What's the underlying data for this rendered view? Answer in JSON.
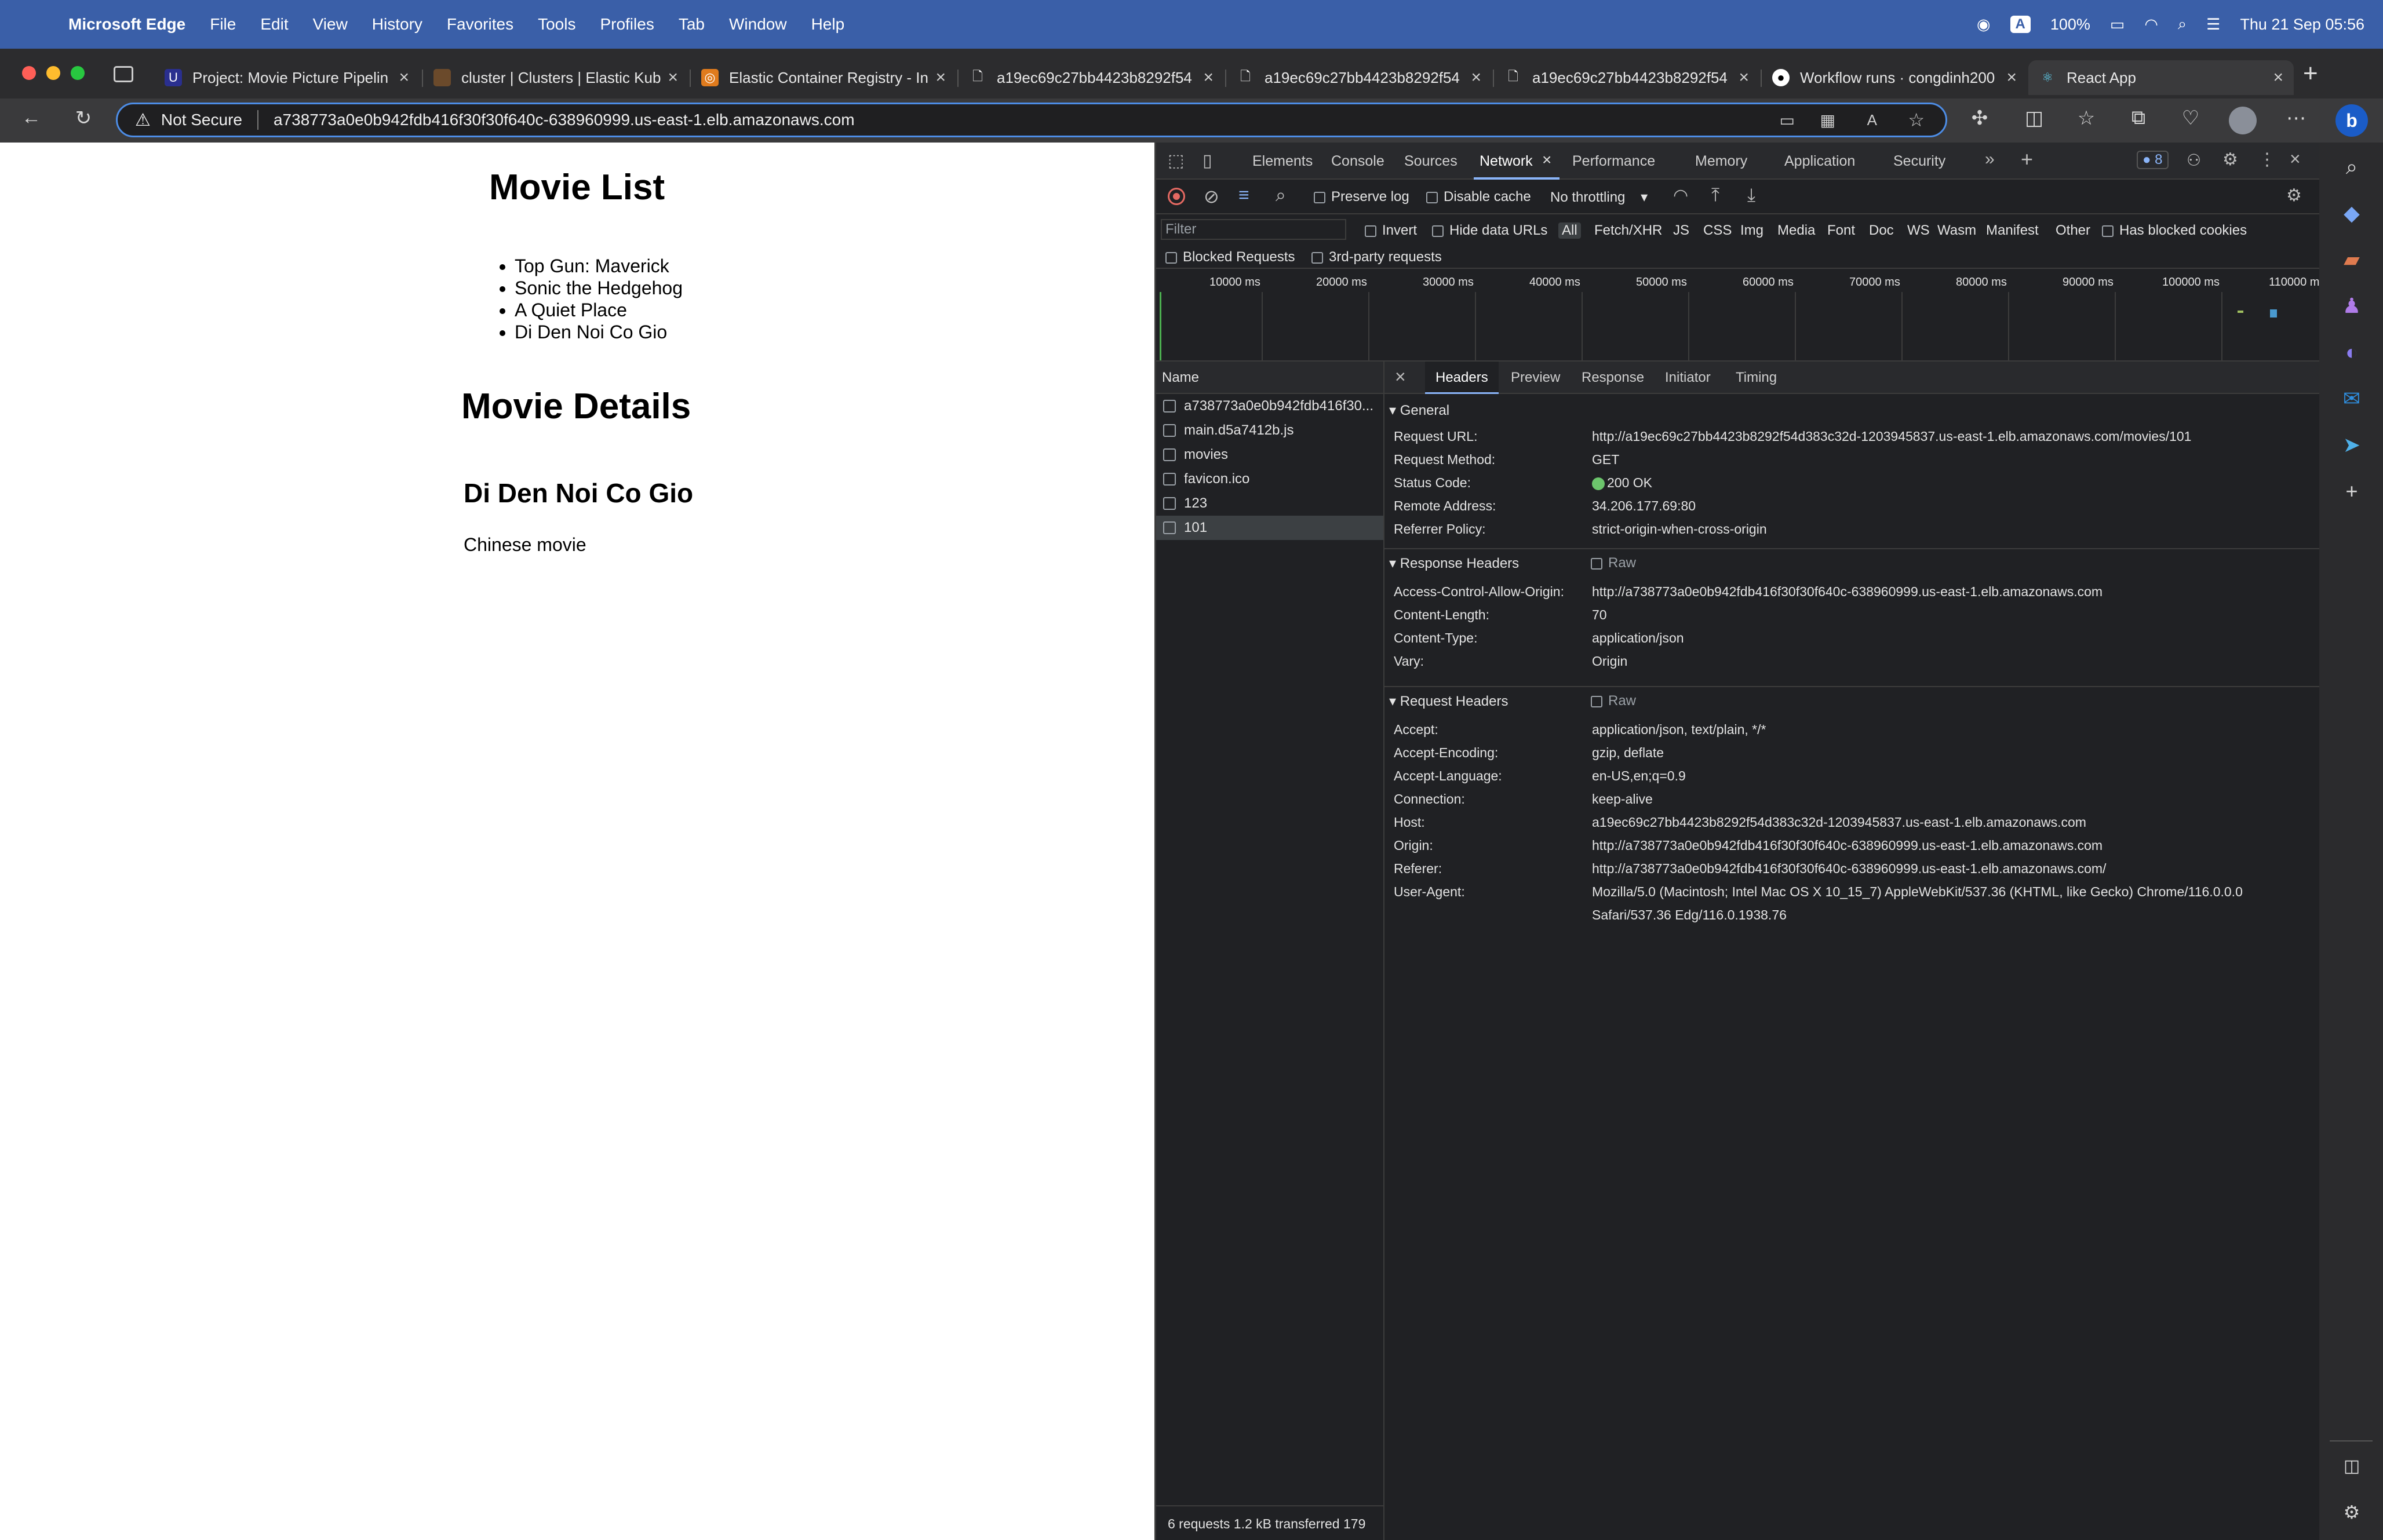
{
  "menubar": {
    "app": "Microsoft Edge",
    "items": [
      "File",
      "Edit",
      "View",
      "History",
      "Favorites",
      "Tools",
      "Profiles",
      "Tab",
      "Window",
      "Help"
    ],
    "status": {
      "letter": "A",
      "battery": "100%",
      "datetime": "Thu 21 Sep  05:56"
    }
  },
  "tabs": [
    {
      "label": "Project: Movie Picture Pipelin",
      "icon": "udacity-icon",
      "color": "#2a2f8f"
    },
    {
      "label": "cluster | Clusters | Elastic Kub",
      "icon": "aws-cube-icon",
      "color": "#6b4a2b"
    },
    {
      "label": "Elastic Container Registry - In",
      "icon": "aws-ecr-icon",
      "color": "#e07b1d"
    },
    {
      "label": "a19ec69c27bb4423b8292f54",
      "icon": "document-icon",
      "color": "#2c2c2e"
    },
    {
      "label": "a19ec69c27bb4423b8292f54",
      "icon": "document-icon",
      "color": "#2c2c2e"
    },
    {
      "label": "a19ec69c27bb4423b8292f54",
      "icon": "document-icon",
      "color": "#2c2c2e"
    },
    {
      "label": "Workflow runs · congdinh200",
      "icon": "github-icon",
      "color": "#2c2c2e"
    },
    {
      "label": "React App",
      "icon": "react-icon",
      "color": "#2c2c2e"
    }
  ],
  "address": {
    "security": "Not Secure",
    "url": "a738773a0e0b942fdb416f30f30f640c-638960999.us-east-1.elb.amazonaws.com"
  },
  "page": {
    "list_title": "Movie List",
    "movies": [
      "Top Gun: Maverick",
      "Sonic the Hedgehog",
      "A Quiet Place",
      "Di Den Noi Co Gio"
    ],
    "details_title": "Movie Details",
    "movie_title": "Di Den Noi Co Gio",
    "movie_description": "Chinese movie"
  },
  "devtools": {
    "tabs": [
      "Elements",
      "Console",
      "Sources",
      "Network",
      "Performance",
      "Memory",
      "Application",
      "Security"
    ],
    "active_tab": "Network",
    "issues_count": "8",
    "controls": {
      "preserve_log": "Preserve log",
      "disable_cache": "Disable cache",
      "throttling": "No throttling"
    },
    "filter": {
      "placeholder": "Filter",
      "invert": "Invert",
      "hide_data_urls": "Hide data URLs",
      "types": [
        "All",
        "Fetch/XHR",
        "JS",
        "CSS",
        "Img",
        "Media",
        "Font",
        "Doc",
        "WS",
        "Wasm",
        "Manifest",
        "Other"
      ],
      "has_blocked_cookies": "Has blocked cookies",
      "blocked_requests": "Blocked Requests",
      "third_party": "3rd-party requests"
    },
    "timeline_ticks": [
      "10000 ms",
      "20000 ms",
      "30000 ms",
      "40000 ms",
      "50000 ms",
      "60000 ms",
      "70000 ms",
      "80000 ms",
      "90000 ms",
      "100000 ms",
      "110000 m"
    ],
    "requests_header": "Name",
    "requests": [
      {
        "name": "a738773a0e0b942fdb416f30..."
      },
      {
        "name": "main.d5a7412b.js"
      },
      {
        "name": "movies"
      },
      {
        "name": "favicon.ico"
      },
      {
        "name": "123"
      },
      {
        "name": "101"
      }
    ],
    "footer": "6 requests  1.2 kB transferred  179",
    "detail_tabs": [
      "Headers",
      "Preview",
      "Response",
      "Initiator",
      "Timing"
    ],
    "general_title": "General",
    "general": [
      {
        "key": "Request URL:",
        "value": "http://a19ec69c27bb4423b8292f54d383c32d-1203945837.us-east-1.elb.amazonaws.com/movies/101"
      },
      {
        "key": "Request Method:",
        "value": "GET"
      },
      {
        "key": "Status Code:",
        "value": "200 OK"
      },
      {
        "key": "Remote Address:",
        "value": "34.206.177.69:80"
      },
      {
        "key": "Referrer Policy:",
        "value": "strict-origin-when-cross-origin"
      }
    ],
    "response_headers_title": "Response Headers",
    "raw_label": "Raw",
    "response_headers": [
      {
        "key": "Access-Control-Allow-Origin:",
        "value": "http://a738773a0e0b942fdb416f30f30f640c-638960999.us-east-1.elb.amazonaws.com"
      },
      {
        "key": "Content-Length:",
        "value": "70"
      },
      {
        "key": "Content-Type:",
        "value": "application/json"
      },
      {
        "key": "Vary:",
        "value": "Origin"
      }
    ],
    "request_headers_title": "Request Headers",
    "request_headers": [
      {
        "key": "Accept:",
        "value": "application/json, text/plain, */*"
      },
      {
        "key": "Accept-Encoding:",
        "value": "gzip, deflate"
      },
      {
        "key": "Accept-Language:",
        "value": "en-US,en;q=0.9"
      },
      {
        "key": "Connection:",
        "value": "keep-alive"
      },
      {
        "key": "Host:",
        "value": "a19ec69c27bb4423b8292f54d383c32d-1203945837.us-east-1.elb.amazonaws.com"
      },
      {
        "key": "Origin:",
        "value": "http://a738773a0e0b942fdb416f30f30f640c-638960999.us-east-1.elb.amazonaws.com"
      },
      {
        "key": "Referer:",
        "value": "http://a738773a0e0b942fdb416f30f30f640c-638960999.us-east-1.elb.amazonaws.com/"
      },
      {
        "key": "User-Agent:",
        "value": "Mozilla/5.0 (Macintosh; Intel Mac OS X 10_15_7) AppleWebKit/537.36 (KHTML, like Gecko) Chrome/116.0.0.0"
      },
      {
        "key": "",
        "value": "Safari/537.36 Edg/116.0.1938.76"
      }
    ]
  },
  "colors": {
    "menubar": "#3a5fa8",
    "devtools_bg": "#202124",
    "accent": "#8ab4f8",
    "status_ok": "#6cc56c"
  }
}
